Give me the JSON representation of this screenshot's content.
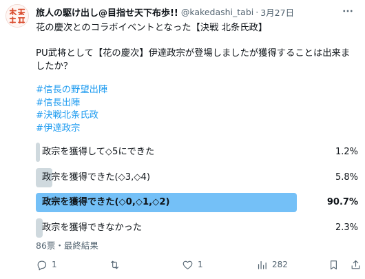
{
  "colors": {
    "text": "#0f1419",
    "secondary": "#536471",
    "link": "#1d9bf0",
    "poll_bar": "#cfd9de",
    "poll_bar_winner": "#74c0f7",
    "avatar_red": "#d94a2c"
  },
  "author": {
    "display_name": "旅人の駆け出し@目指せ天下布歩!!",
    "handle": "@kakedashi_tabi",
    "separator": "·",
    "date": "3月27日",
    "avatar_icon": "avatar-logo-icon"
  },
  "tweet": {
    "line1": "花の慶次とのコラボイベントとなった【決戦 北条氏政】",
    "question": "PU武将として【花の慶次】伊達政宗が登場しましたが獲得することは出来ましたか？",
    "hashtags": [
      "#信長の野望出陣",
      "#信長出陣",
      "#決戦北条氏政",
      "#伊達政宗"
    ]
  },
  "poll": {
    "options": [
      {
        "label": "政宗を獲得して◇5にできた",
        "percent_text": "1.2%",
        "percent": 1.2,
        "winner": false
      },
      {
        "label": "政宗を獲得できた(◇3,◇4)",
        "percent_text": "5.8%",
        "percent": 5.8,
        "winner": false
      },
      {
        "label": "政宗を獲得できた(◇0,◇1,◇2)",
        "percent_text": "90.7%",
        "percent": 90.7,
        "winner": true
      },
      {
        "label": "政宗を獲得できなかった",
        "percent_text": "2.3%",
        "percent": 2.3,
        "winner": false
      }
    ],
    "meta": "86票・最終結果"
  },
  "actions": {
    "reply": {
      "icon": "reply-icon",
      "count": "1"
    },
    "retweet": {
      "icon": "retweet-icon",
      "count": ""
    },
    "like": {
      "icon": "heart-icon",
      "count": "1"
    },
    "views": {
      "icon": "views-icon",
      "count": "282"
    },
    "bookmark": {
      "icon": "bookmark-icon"
    },
    "share": {
      "icon": "share-icon"
    }
  }
}
